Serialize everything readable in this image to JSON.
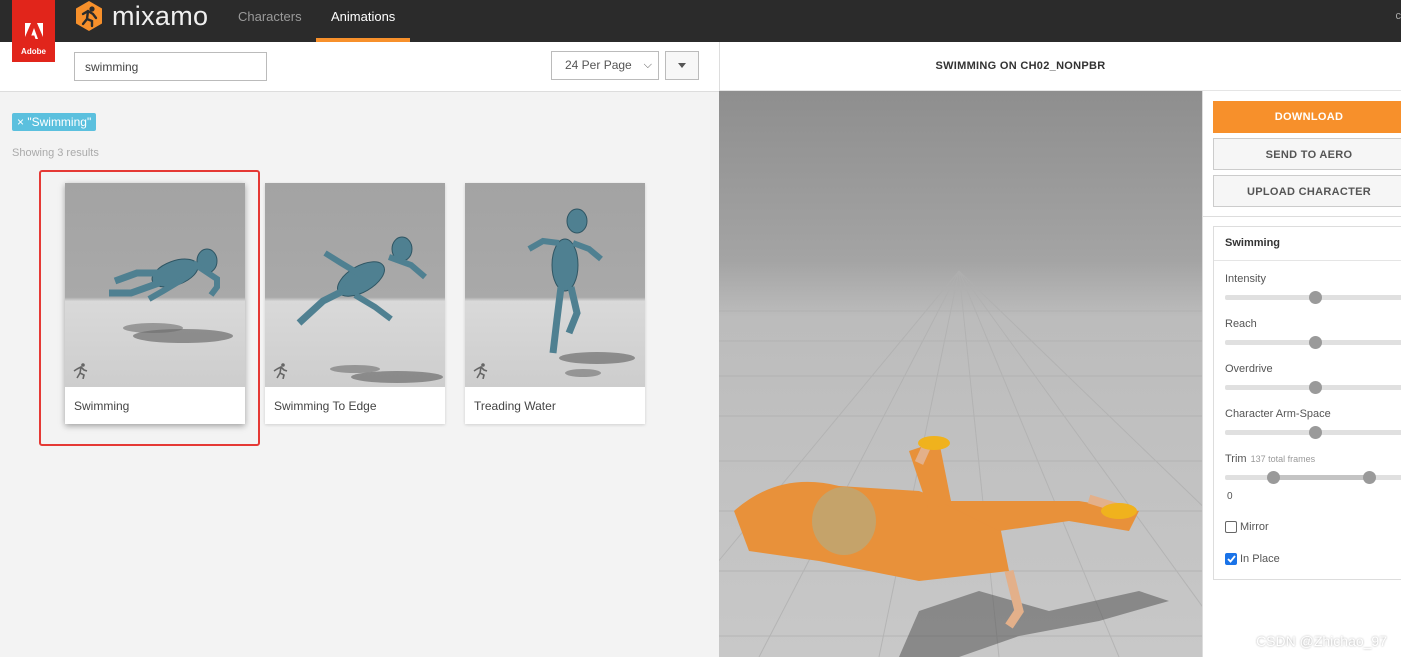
{
  "topbar": {
    "adobe_label": "Adobe",
    "brand": "mixamo",
    "tabs": [
      {
        "label": "Characters",
        "active": false
      },
      {
        "label": "Animations",
        "active": true
      }
    ],
    "right_partial": "c",
    "accent_color": "#f7902b"
  },
  "search": {
    "value": "swimming",
    "per_page": "24 Per Page",
    "filter_tag": "× \"Swimming\"",
    "results_text": "Showing 3 results"
  },
  "cards": [
    {
      "label": "Swimming",
      "selected": true
    },
    {
      "label": "Swimming To Edge",
      "selected": false
    },
    {
      "label": "Treading Water",
      "selected": false
    }
  ],
  "viewer": {
    "title": "SWIMMING ON CH02_NONPBR"
  },
  "actions": {
    "download": "DOWNLOAD",
    "send_to_aero": "SEND TO AERO",
    "upload_character": "UPLOAD CHARACTER"
  },
  "settings": {
    "title": "Swimming",
    "params": [
      {
        "label": "Intensity",
        "value": 0.5
      },
      {
        "label": "Reach",
        "value": 0.5
      },
      {
        "label": "Overdrive",
        "value": 0.5
      },
      {
        "label": "Character Arm-Space",
        "value": 0.5
      }
    ],
    "trim": {
      "label": "Trim",
      "sub": "137 total frames",
      "start_fraction": 0.27,
      "end_fraction": 0.8,
      "value": "0"
    },
    "mirror": {
      "label": "Mirror",
      "checked": false
    },
    "in_place": {
      "label": "In Place",
      "checked": true
    }
  },
  "watermark": "CSDN @Zhichao_97"
}
